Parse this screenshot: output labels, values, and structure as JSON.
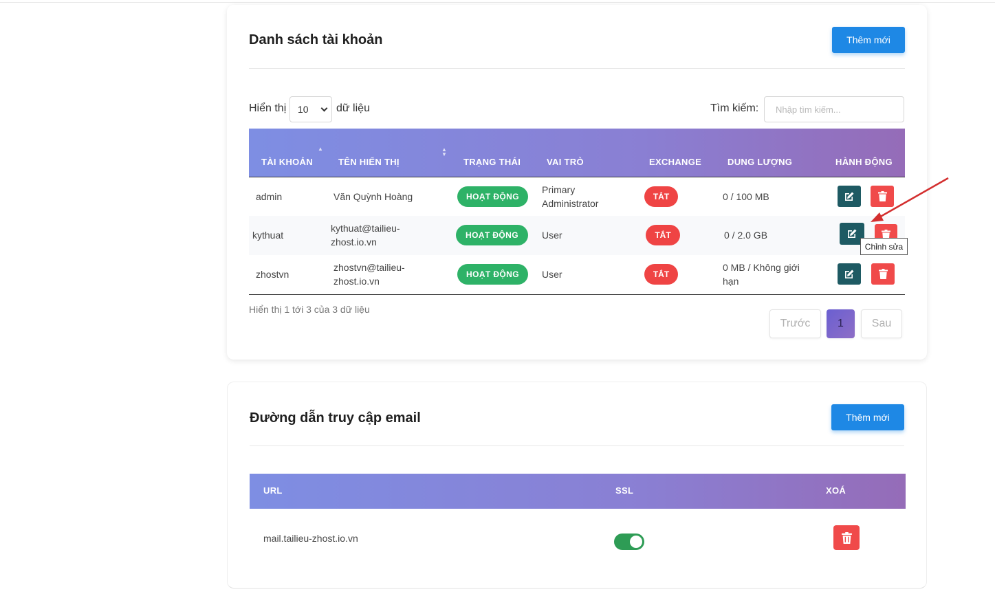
{
  "accounts_card": {
    "title": "Danh sách tài khoản",
    "add_button": "Thêm mới",
    "length_prefix": "Hiển thị",
    "length_value": "10",
    "length_suffix": "dữ liệu",
    "search_label": "Tìm kiếm:",
    "search_placeholder": "Nhập tìm kiếm...",
    "columns": [
      "TÀI KHOẢN",
      "TÊN HIỂN THỊ",
      "TRẠNG THÁI",
      "VAI TRÒ",
      "EXCHANGE",
      "DUNG LƯỢNG",
      "HÀNH ĐỘNG"
    ],
    "rows": [
      {
        "account": "admin",
        "display_name": "Văn Quỳnh Hoàng",
        "status": "HOẠT ĐỘNG",
        "role": "Primary Administrator",
        "exchange": "TẮT",
        "storage": "0 / 100 MB"
      },
      {
        "account": "kythuat",
        "display_name": "kythuat@tailieu-zhost.io.vn",
        "status": "HOẠT ĐỘNG",
        "role": "User",
        "exchange": "TẮT",
        "storage": "0 / 2.0 GB"
      },
      {
        "account": "zhostvn",
        "display_name": "zhostvn@tailieu-zhost.io.vn",
        "status": "HOẠT ĐỘNG",
        "role": "User",
        "exchange": "TẮT",
        "storage": "0 MB / Không giới hạn"
      }
    ],
    "tooltip": "Chỉnh sửa",
    "info": "Hiển thị 1 tới 3 của 3 dữ liệu",
    "pagination": {
      "prev": "Trước",
      "current": "1",
      "next": "Sau"
    }
  },
  "email_card": {
    "title": "Đường dẫn truy cập email",
    "add_button": "Thêm mới",
    "columns": [
      "URL",
      "SSL",
      "XOÁ"
    ],
    "rows": [
      {
        "url": "mail.tailieu-zhost.io.vn",
        "ssl": "on"
      }
    ]
  },
  "colors": {
    "primary": "#1e88e5",
    "success": "#2eb267",
    "danger": "#ef4444",
    "edit": "#1e5a63",
    "arrow": "#d32f2f"
  },
  "icons": {
    "edit": "edit-icon",
    "delete": "trash-icon"
  }
}
